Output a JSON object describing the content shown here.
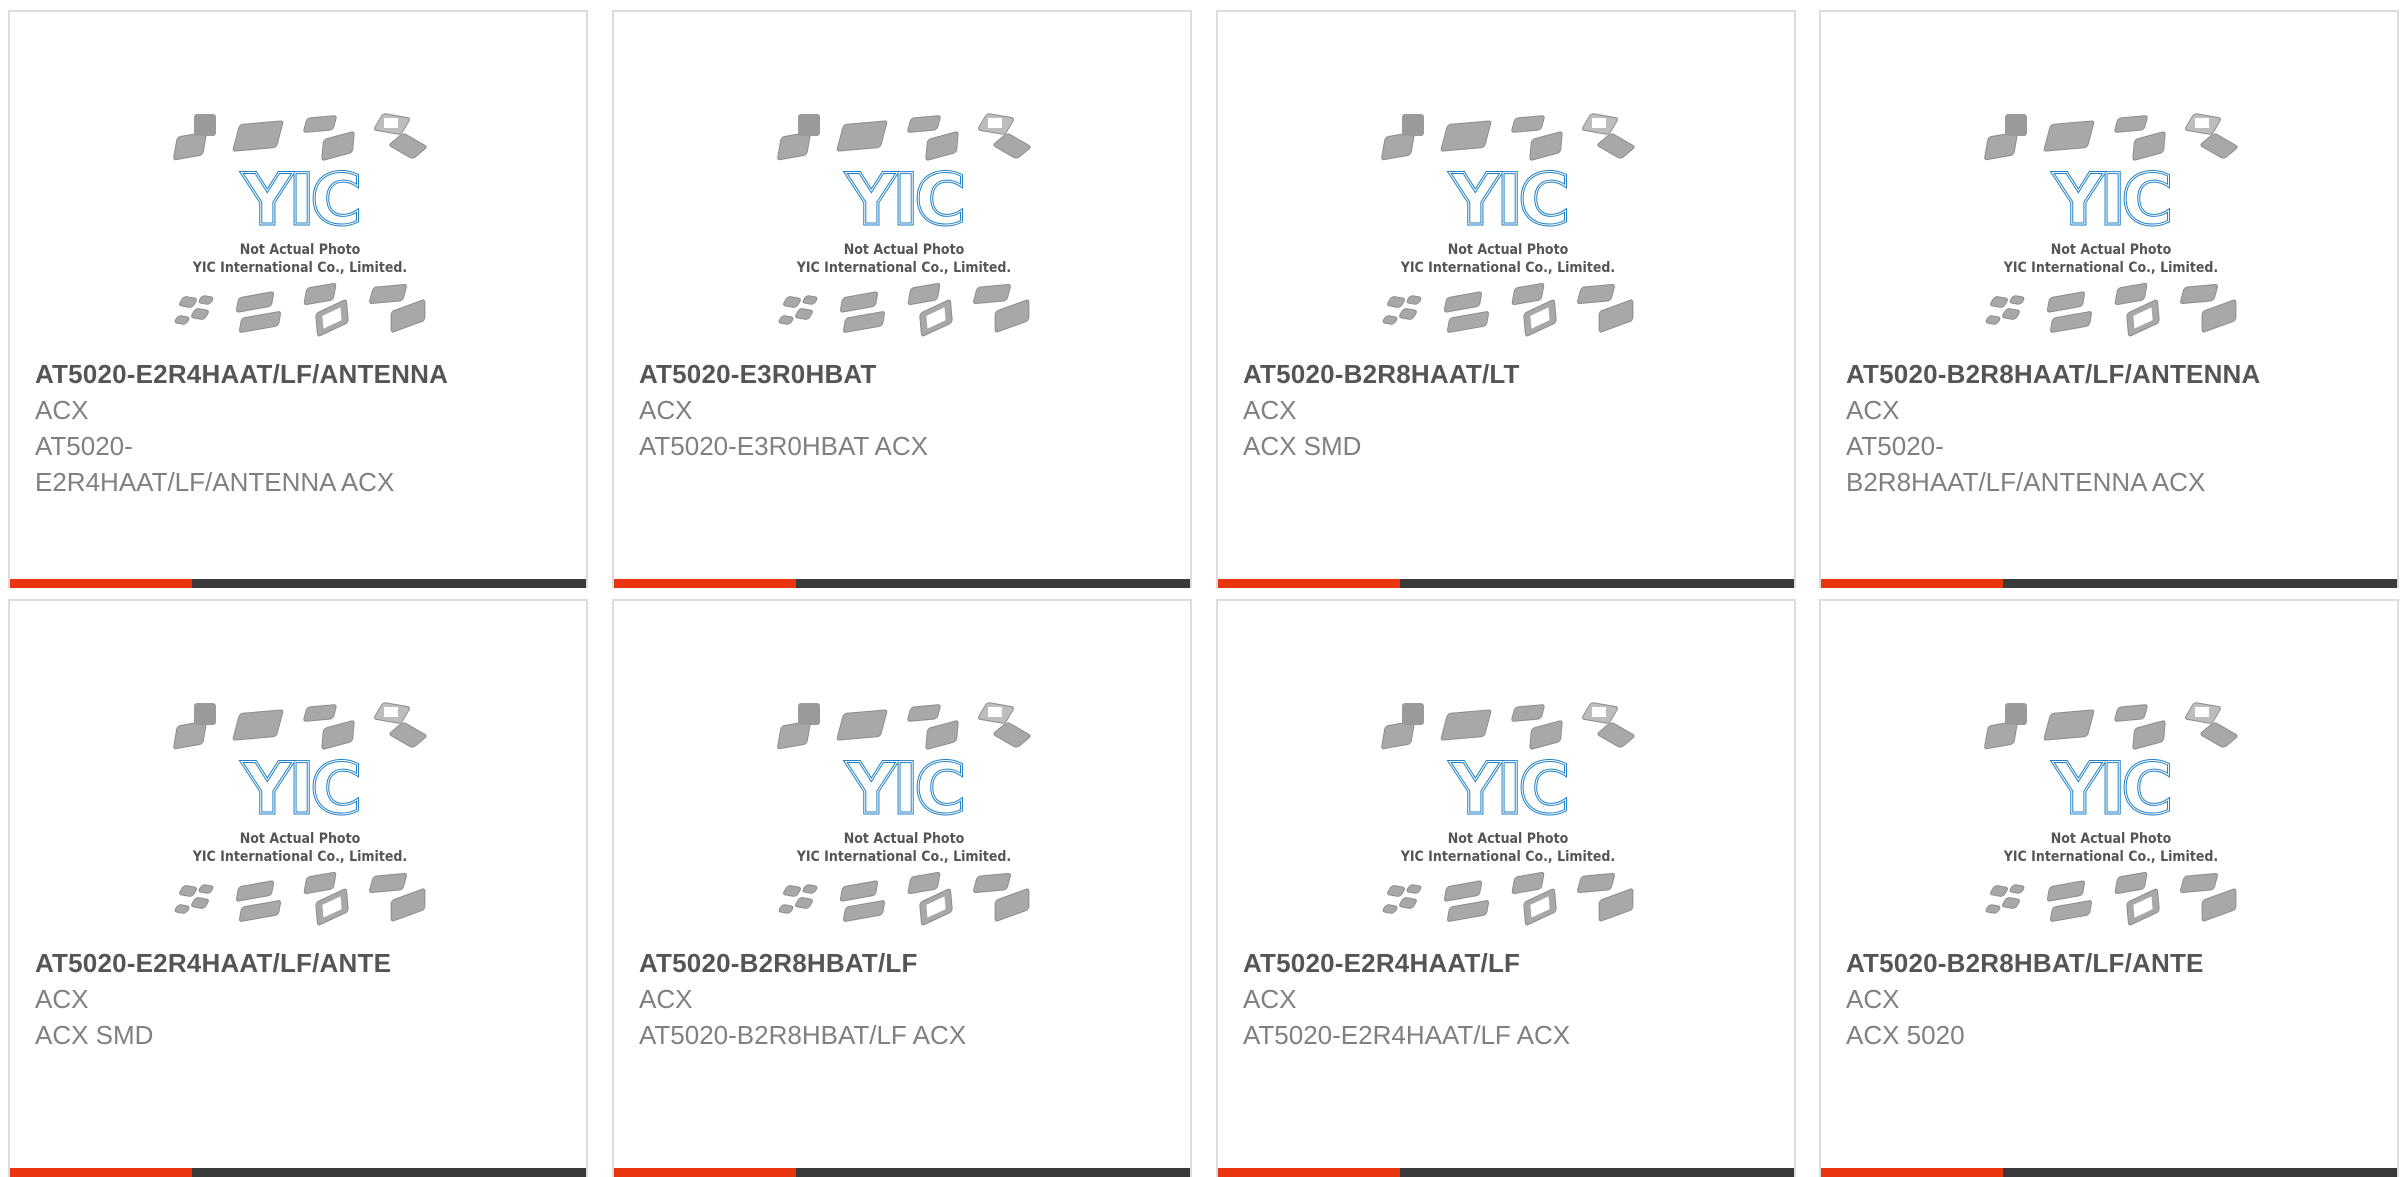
{
  "colors": {
    "accent": "#e8350f",
    "bar": "#3a3a3a",
    "logo_blue": "#1f7fc4",
    "chip_gray": "#a8a8a8"
  },
  "placeholder": {
    "logo_text": "YIC",
    "line1": "Not Actual Photo",
    "line2": "YIC International Co., Limited."
  },
  "products": [
    {
      "part": "AT5020-E2R4HAAT/LF/ANTENNA",
      "mfr": "ACX",
      "desc": "AT5020-\nE2R4HAAT/LF/ANTENNA ACX"
    },
    {
      "part": "AT5020-E3R0HBAT",
      "mfr": "ACX",
      "desc": "AT5020-E3R0HBAT ACX"
    },
    {
      "part": "AT5020-B2R8HAAT/LT",
      "mfr": "ACX",
      "desc": "ACX SMD"
    },
    {
      "part": "AT5020-B2R8HAAT/LF/ANTENNA",
      "mfr": "ACX",
      "desc": "AT5020-\nB2R8HAAT/LF/ANTENNA ACX"
    },
    {
      "part": "AT5020-E2R4HAAT/LF/ANTE",
      "mfr": "ACX",
      "desc": "ACX SMD"
    },
    {
      "part": "AT5020-B2R8HBAT/LF",
      "mfr": "ACX",
      "desc": "AT5020-B2R8HBAT/LF ACX"
    },
    {
      "part": "AT5020-E2R4HAAT/LF",
      "mfr": "ACX",
      "desc": "AT5020-E2R4HAAT/LF ACX"
    },
    {
      "part": "AT5020-B2R8HBAT/LF/ANTE",
      "mfr": "ACX",
      "desc": "ACX 5020"
    }
  ]
}
